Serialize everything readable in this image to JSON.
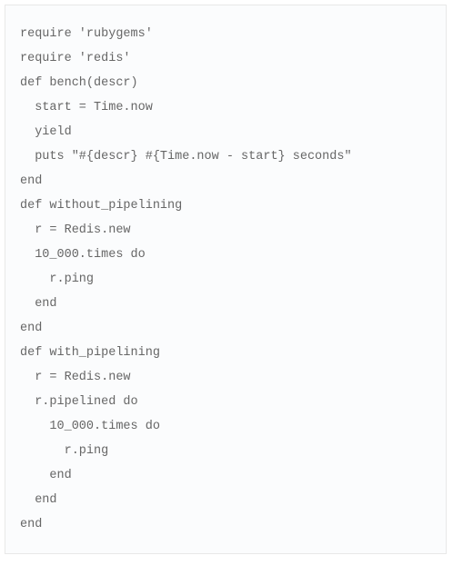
{
  "code": {
    "lines": [
      "require 'rubygems'",
      "require 'redis'",
      "",
      "def bench(descr)",
      "  start = Time.now",
      "  yield",
      "  puts \"#{descr} #{Time.now - start} seconds\"",
      "end",
      "",
      "def without_pipelining",
      "  r = Redis.new",
      "  10_000.times do",
      "    r.ping",
      "  end",
      "end",
      "",
      "def with_pipelining",
      "  r = Redis.new",
      "  r.pipelined do",
      "    10_000.times do",
      "      r.ping",
      "    end",
      "  end",
      "end"
    ]
  }
}
